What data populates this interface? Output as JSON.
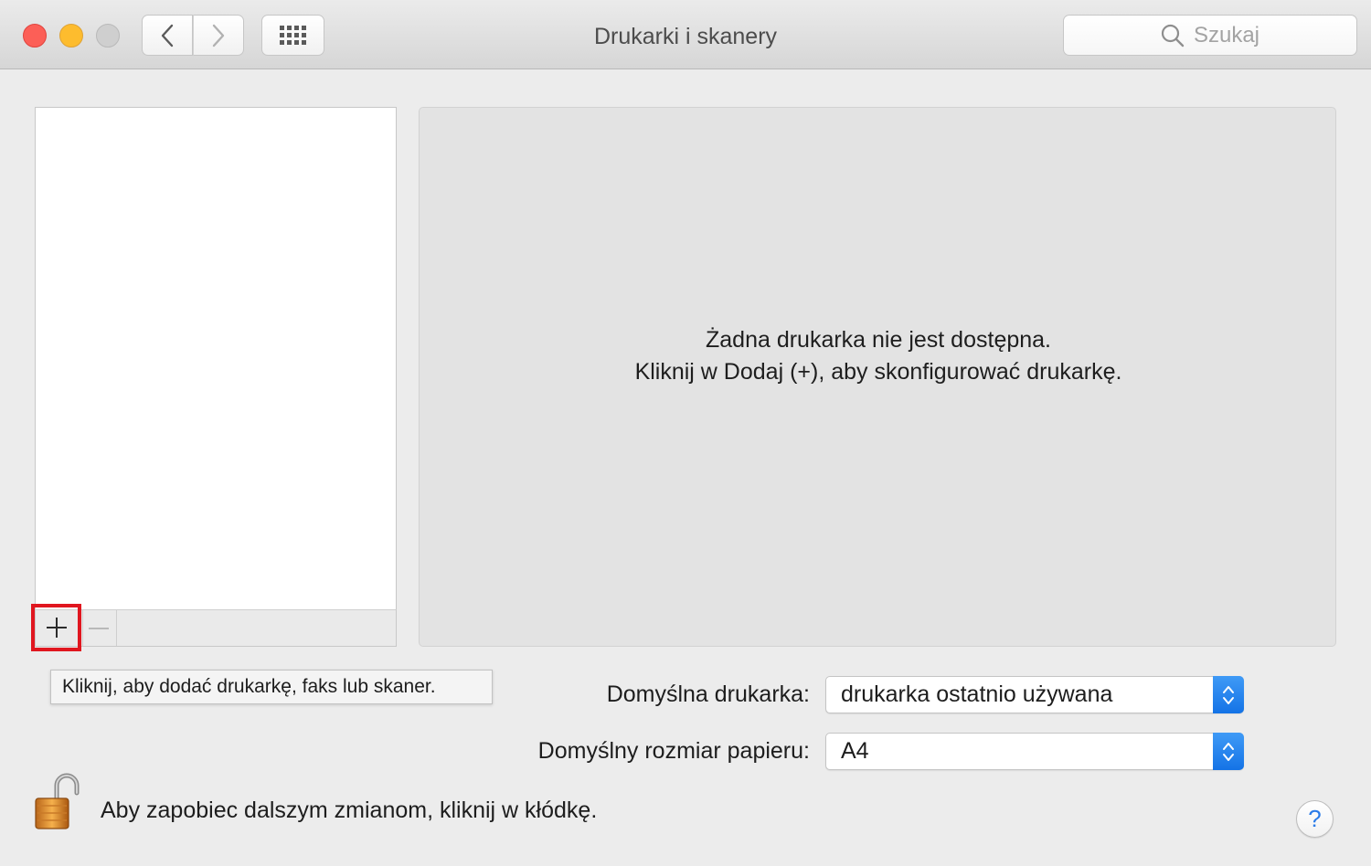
{
  "window": {
    "title": "Drukarki i skanery"
  },
  "toolbar": {
    "back_icon": "chevron-left-icon",
    "forward_icon": "chevron-right-icon",
    "grid_icon": "show-all-grid-icon",
    "search_placeholder": "Szukaj"
  },
  "printer_list": {
    "items": [],
    "add_label": "+",
    "remove_label": "—"
  },
  "tooltip": {
    "text": "Kliknij, aby dodać drukarkę, faks lub skaner."
  },
  "detail": {
    "line1": "Żadna drukarka nie jest dostępna.",
    "line2": "Kliknij w Dodaj (+), aby skonfigurować drukarkę."
  },
  "settings": {
    "default_printer_label": "Domyślna drukarka:",
    "default_printer_value": "drukarka ostatnio używana",
    "paper_size_label": "Domyślny rozmiar papieru:",
    "paper_size_value": "A4"
  },
  "footer": {
    "lock_text": "Aby zapobiec dalszym zmianom, kliknij w kłódkę.",
    "help_label": "?"
  },
  "colors": {
    "accent": "#1473e6",
    "highlight_frame": "#e0161f",
    "close": "#fc5f57",
    "minimize": "#fdbc2e"
  }
}
